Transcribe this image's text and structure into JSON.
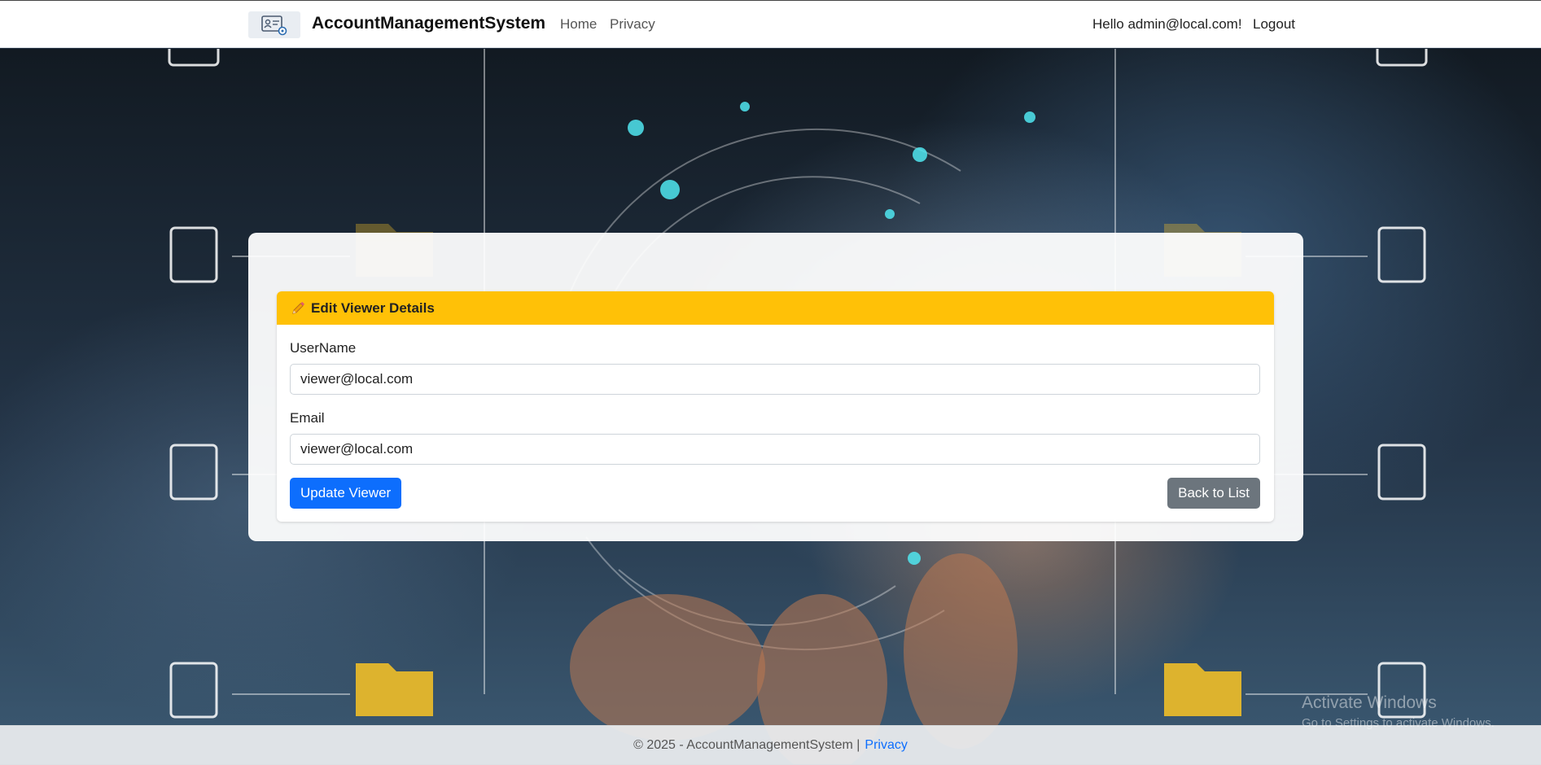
{
  "navbar": {
    "logo_icon": "account-settings-icon",
    "brand": "AccountManagementSystem",
    "links": [
      {
        "label": "Home"
      },
      {
        "label": "Privacy"
      }
    ],
    "greeting": "Hello admin@local.com!",
    "logout": "Logout"
  },
  "form": {
    "header_icon": "pencil-icon",
    "title": "Edit Viewer Details",
    "username_label": "UserName",
    "username_value": "viewer@local.com",
    "email_label": "Email",
    "email_value": "viewer@local.com",
    "submit_label": "Update Viewer",
    "back_label": "Back to List"
  },
  "footer": {
    "copyright": "© 2025 - AccountManagementSystem |",
    "privacy_link": "Privacy"
  },
  "watermark": {
    "line1": "Activate Windows",
    "line2": "Go to Settings to activate Windows."
  },
  "colors": {
    "header_accent": "#ffc107",
    "primary": "#0d6efd",
    "secondary": "#6c757d"
  }
}
